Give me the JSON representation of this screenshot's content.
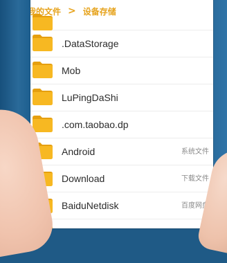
{
  "breadcrumb": {
    "parent_label": "我的文件",
    "separator": ">",
    "current_label": "设备存储"
  },
  "folders": [
    {
      "name": "",
      "desc": ""
    },
    {
      "name": ".DataStorage",
      "desc": ""
    },
    {
      "name": "Mob",
      "desc": ""
    },
    {
      "name": "LuPingDaShi",
      "desc": ""
    },
    {
      "name": ".com.taobao.dp",
      "desc": ""
    },
    {
      "name": "Android",
      "desc": "系统文件"
    },
    {
      "name": "Download",
      "desc": "下载文件"
    },
    {
      "name": "BaiduNetdisk",
      "desc": "百度网盘"
    },
    {
      "name": "",
      "desc": ""
    }
  ],
  "colors": {
    "accent": "#e6a31d",
    "folder": "#f7b822",
    "folder_dark": "#e59f0f",
    "background": "#1f5a86"
  },
  "icons": {
    "folder": "folder-icon",
    "separator": "chevron-right-icon"
  }
}
